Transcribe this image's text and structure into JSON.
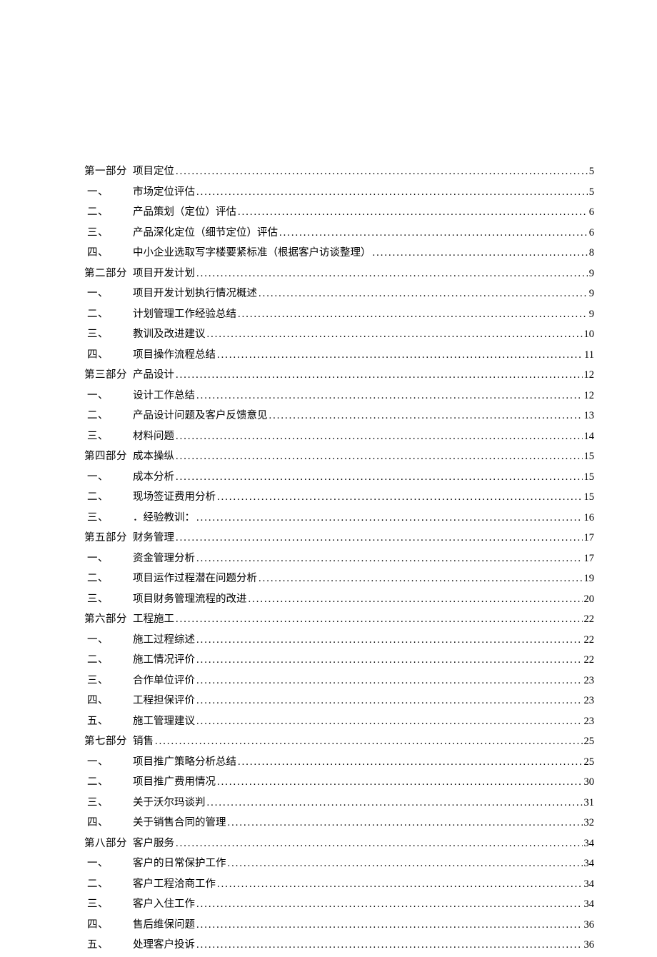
{
  "toc": [
    {
      "label": "第一部分",
      "title": "项目定位",
      "page": "5",
      "sub": false
    },
    {
      "label": "一、",
      "title": "市场定位评估",
      "page": "5",
      "sub": true
    },
    {
      "label": "二、",
      "title": "产品策划（定位）评估",
      "page": "6",
      "sub": true
    },
    {
      "label": "三、",
      "title": "产品深化定位（细节定位）评估",
      "page": "6",
      "sub": true
    },
    {
      "label": "四、",
      "title": "中小企业选取写字楼要紧标准（根据客户访谈整理）",
      "page": "8",
      "sub": true
    },
    {
      "label": "第二部分",
      "title": "项目开发计划",
      "page": "9",
      "sub": false
    },
    {
      "label": "一、",
      "title": "项目开发计划执行情况概述",
      "page": "9",
      "sub": true
    },
    {
      "label": "二、",
      "title": "计划管理工作经验总结",
      "page": "9",
      "sub": true
    },
    {
      "label": "三、",
      "title": "教训及改进建议",
      "page": "10",
      "sub": true
    },
    {
      "label": "四、",
      "title": "项目操作流程总结",
      "page": "11",
      "sub": true
    },
    {
      "label": "第三部分",
      "title": "产品设计",
      "page": "12",
      "sub": false
    },
    {
      "label": "一、",
      "title": "设计工作总结",
      "page": "12",
      "sub": true
    },
    {
      "label": "二、",
      "title": "产品设计问题及客户反馈意见",
      "page": "13",
      "sub": true
    },
    {
      "label": "三、",
      "title": "材料问题",
      "page": "14",
      "sub": true
    },
    {
      "label": "第四部分",
      "title": "成本操纵",
      "page": "15",
      "sub": false
    },
    {
      "label": "一、",
      "title": "成本分析",
      "page": "15",
      "sub": true
    },
    {
      "label": "二、",
      "title": "现场签证费用分析",
      "page": "15",
      "sub": true
    },
    {
      "label": "三、",
      "title": "．经验教训：",
      "page": "16",
      "sub": true
    },
    {
      "label": "第五部分",
      "title": "财务管理",
      "page": "17",
      "sub": false
    },
    {
      "label": "一、",
      "title": "资金管理分析",
      "page": "17",
      "sub": true
    },
    {
      "label": "二、",
      "title": "项目运作过程潜在问题分析",
      "page": "19",
      "sub": true
    },
    {
      "label": "三、",
      "title": "项目财务管理流程的改进",
      "page": "20",
      "sub": true
    },
    {
      "label": "第六部分",
      "title": "工程施工",
      "page": "22",
      "sub": false
    },
    {
      "label": "一、",
      "title": "施工过程综述",
      "page": "22",
      "sub": true
    },
    {
      "label": "二、",
      "title": "施工情况评价",
      "page": "22",
      "sub": true
    },
    {
      "label": "三、",
      "title": "合作单位评价",
      "page": "23",
      "sub": true
    },
    {
      "label": "四、",
      "title": "工程担保评价",
      "page": "23",
      "sub": true
    },
    {
      "label": "五、",
      "title": "施工管理建议",
      "page": "23",
      "sub": true
    },
    {
      "label": "第七部分",
      "title": "销售",
      "page": "25",
      "sub": false
    },
    {
      "label": "一、",
      "title": "项目推广策略分析总结",
      "page": "25",
      "sub": true
    },
    {
      "label": "二、",
      "title": "项目推广费用情况",
      "page": "30",
      "sub": true
    },
    {
      "label": "三、",
      "title": "关于沃尔玛谈判",
      "page": "31",
      "sub": true
    },
    {
      "label": "四、",
      "title": "关于销售合同的管理",
      "page": "32",
      "sub": true
    },
    {
      "label": "第八部分",
      "title": "客户服务",
      "page": "34",
      "sub": false
    },
    {
      "label": "一、",
      "title": "客户的日常保护工作",
      "page": "34",
      "sub": true
    },
    {
      "label": "二、",
      "title": "客户工程洽商工作",
      "page": "34",
      "sub": true
    },
    {
      "label": "三、",
      "title": "客户入住工作",
      "page": "34",
      "sub": true
    },
    {
      "label": "四、",
      "title": "售后维保问题",
      "page": "36",
      "sub": true
    },
    {
      "label": "五、",
      "title": "处理客户投诉",
      "page": "36",
      "sub": true
    }
  ]
}
